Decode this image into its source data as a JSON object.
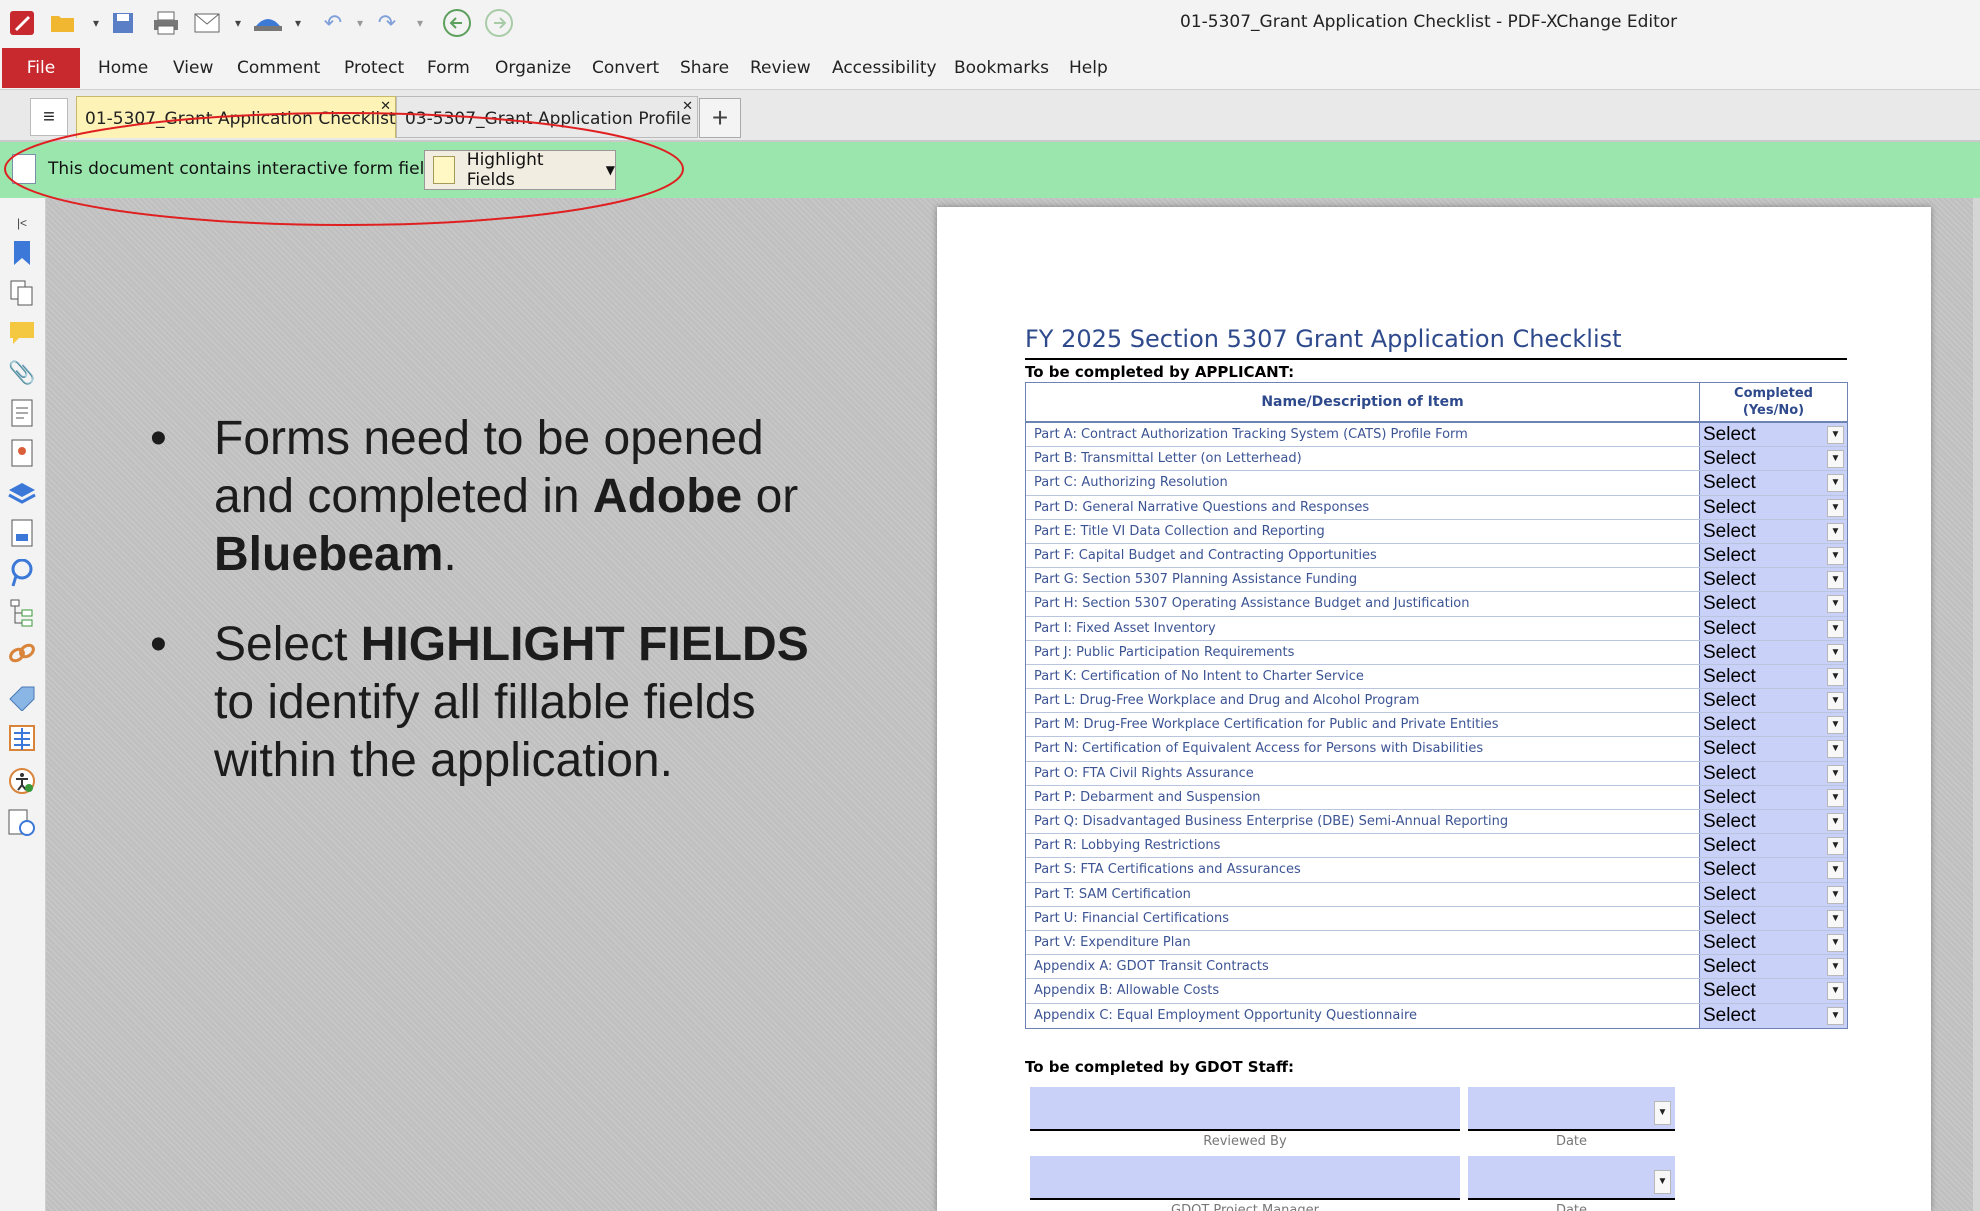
{
  "window": {
    "title": "01-5307_Grant Application Checklist - PDF-XChange Editor"
  },
  "menu": {
    "file": "File",
    "items": [
      "Home",
      "View",
      "Comment",
      "Protect",
      "Form",
      "Organize",
      "Convert",
      "Share",
      "Review",
      "Accessibility",
      "Bookmarks",
      "Help"
    ]
  },
  "tabs": [
    {
      "label": "01-5307_Grant Application Checklist",
      "active": true
    },
    {
      "label": "03-5307_Grant Application Profile",
      "active": false
    }
  ],
  "formbar": {
    "message": "This document contains interactive form fields.",
    "button": "Highlight Fields"
  },
  "slide": {
    "bullet1": {
      "prefix": "Forms need to be opened and completed in ",
      "bold1": "Adobe",
      "middle": " or ",
      "bold2": "Bluebeam",
      "suffix": "."
    },
    "bullet2": {
      "prefix": "Select ",
      "bold": "HIGHLIGHT FIELDS",
      "suffix": " to identify all fillable fields within the application."
    }
  },
  "document": {
    "title": "FY 2025 Section 5307 Grant Application Checklist",
    "applicant_label": "To be completed by APPLICANT:",
    "col_name": "Name/Description of Item",
    "col_completed_line1": "Completed",
    "col_completed_line2": "(Yes/No)",
    "select_text": "Select",
    "items": [
      "Part A: Contract Authorization Tracking System (CATS) Profile Form",
      "Part B: Transmittal Letter (on Letterhead)",
      "Part C: Authorizing Resolution",
      "Part D: General Narrative Questions and Responses",
      "Part E: Title VI Data Collection and Reporting",
      "Part F: Capital Budget and Contracting Opportunities",
      "Part G: Section 5307 Planning Assistance Funding",
      "Part H: Section 5307 Operating Assistance Budget and Justification",
      "Part I: Fixed Asset Inventory",
      "Part J: Public Participation Requirements",
      "Part K: Certification of No Intent to Charter Service",
      "Part L: Drug-Free Workplace and Drug and Alcohol Program",
      "Part M: Drug-Free Workplace Certification for Public and Private Entities",
      "Part N: Certification of Equivalent Access for Persons with Disabilities",
      "Part O: FTA Civil Rights Assurance",
      "Part P: Debarment and Suspension",
      "Part Q: Disadvantaged Business Enterprise (DBE) Semi-Annual Reporting",
      "Part R: Lobbying Restrictions",
      "Part S: FTA Certifications and Assurances",
      "Part T: SAM Certification",
      "Part U: Financial Certifications",
      "Part V: Expenditure Plan",
      "Appendix A: GDOT Transit Contracts",
      "Appendix B: Allowable Costs",
      "Appendix C: Equal Employment Opportunity Questionnaire"
    ],
    "staff_label": "To be completed by GDOT Staff:",
    "reviewed_by": "Reviewed By",
    "date": "Date",
    "project_manager": "GDOT Project Manager"
  },
  "colors": {
    "file_red": "#c8292e",
    "formbar_green": "#9ae6ad",
    "field_blue": "#c9d1f9",
    "title_blue": "#2e4a8c"
  }
}
